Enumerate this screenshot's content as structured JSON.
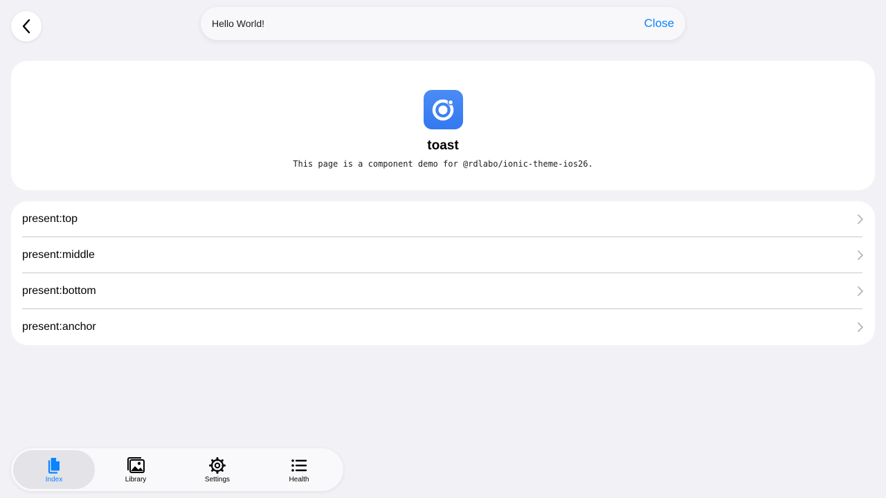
{
  "header": {
    "back_icon": "chevron-back-icon"
  },
  "toast": {
    "message": "Hello World!",
    "close_label": "Close"
  },
  "hero": {
    "logo_icon": "ionic-logo-icon",
    "title": "toast",
    "subtitle": "This page is a component demo for @rdlabo/ionic-theme-ios26."
  },
  "list": {
    "items": [
      {
        "label": "present:top"
      },
      {
        "label": "present:middle"
      },
      {
        "label": "present:bottom"
      },
      {
        "label": "present:anchor"
      }
    ]
  },
  "tabs": [
    {
      "label": "Index",
      "icon": "documents-icon",
      "selected": true
    },
    {
      "label": "Library",
      "icon": "images-icon",
      "selected": false
    },
    {
      "label": "Settings",
      "icon": "gear-icon",
      "selected": false
    },
    {
      "label": "Health",
      "icon": "list-icon",
      "selected": false
    }
  ],
  "colors": {
    "accent": "#0a84ff",
    "background": "#f2f2f6",
    "logo": "#3478f0"
  }
}
